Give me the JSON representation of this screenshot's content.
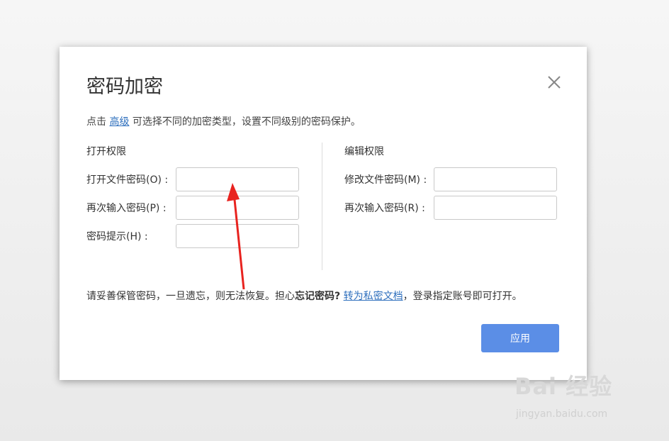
{
  "dialog": {
    "title": "密码加密",
    "intro_prefix": "点击",
    "intro_link": "高级",
    "intro_suffix": "可选择不同的加密类型，设置不同级别的密码保护。",
    "open_section": {
      "title": "打开权限",
      "open_password_label": "打开文件密码(O) :",
      "open_password_value": "",
      "reenter_label": "再次输入密码(P) :",
      "reenter_value": "",
      "hint_label": "密码提示(H) :",
      "hint_value": ""
    },
    "edit_section": {
      "title": "编辑权限",
      "modify_password_label": "修改文件密码(M) :",
      "modify_password_value": "",
      "reenter_label": "再次输入密码(R) :",
      "reenter_value": ""
    },
    "note_prefix": "请妥善保管密码，一旦遗忘，则无法恢复。担心",
    "note_bold": "忘记密码?",
    "note_link": "转为私密文档",
    "note_suffix": "，登录指定账号即可打开。",
    "apply_label": "应用"
  },
  "annotation": {
    "arrow_color": "#e8231f"
  },
  "watermark": {
    "logo": "Bai 经验",
    "url": "jingyan.baidu.com"
  }
}
